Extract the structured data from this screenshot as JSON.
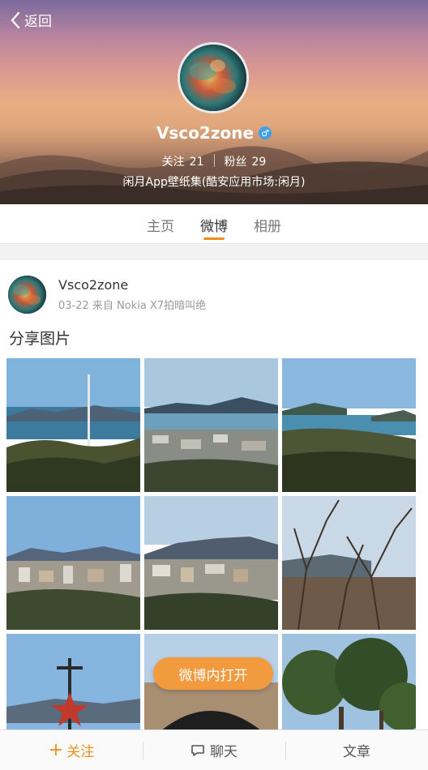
{
  "header": {
    "back_label": "返回",
    "username": "Vsco2zone",
    "gender_symbol": "♂",
    "follow_label": "关注",
    "follow_count": "21",
    "fans_label": "粉丝",
    "fans_count": "29",
    "bio": "闲月App壁纸集(酷安应用市场:闲月)"
  },
  "tabs": [
    {
      "label": "主页",
      "active": false
    },
    {
      "label": "微博",
      "active": true
    },
    {
      "label": "相册",
      "active": false
    }
  ],
  "post": {
    "author": "Vsco2zone",
    "meta": "03-22 来自 Nokia X7拍暗叫绝",
    "text": "分享图片",
    "images": [
      "coastal-tower",
      "harbor-city",
      "bay-islands",
      "city-hills",
      "city-port",
      "bare-trees",
      "red-star-monument",
      "tunnel",
      "pine-trees"
    ]
  },
  "open_in_app_label": "微博内打开",
  "bottom_bar": {
    "follow_label": "关注",
    "chat_label": "聊天",
    "article_label": "文章"
  },
  "colors": {
    "accent": "#f28c1e",
    "gender_badge": "#3fa0e8",
    "pill": "#f29a3e"
  }
}
